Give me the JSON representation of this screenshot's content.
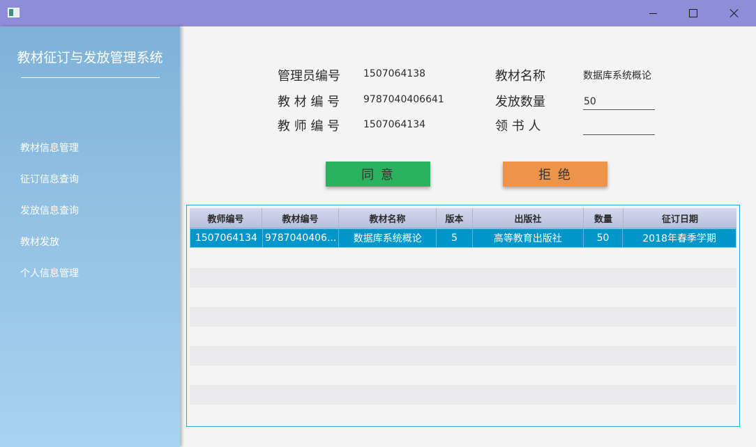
{
  "window": {
    "minimize_icon": "minimize-icon",
    "maximize_icon": "maximize-icon",
    "close_icon": "close-icon"
  },
  "sidebar": {
    "title": "教材征订与发放管理系统",
    "items": [
      {
        "label": "教材信息管理"
      },
      {
        "label": "征订信息查询"
      },
      {
        "label": "发放信息查询"
      },
      {
        "label": "教材发放"
      },
      {
        "label": "个人信息管理"
      }
    ]
  },
  "form": {
    "admin_id_label": "管理员编号",
    "admin_id_value": "1507064138",
    "textbook_id_label": "教 材 编 号",
    "textbook_id_value": "9787040406641",
    "teacher_id_label": "教 师 编 号",
    "teacher_id_value": "1507064134",
    "textbook_name_label": "教材名称",
    "textbook_name_value": "数据库系统概论",
    "quantity_label": "发放数量",
    "quantity_value": "50",
    "recipient_label": "领 书 人",
    "recipient_value": ""
  },
  "actions": {
    "agree_label": "同  意",
    "reject_label": "拒  绝"
  },
  "table": {
    "columns": [
      "教师编号",
      "教材编号",
      "教材名称",
      "版本",
      "出版社",
      "数量",
      "征订日期"
    ],
    "rows": [
      [
        "1507064134",
        "9787040406...",
        "数据库系统概论",
        "5",
        "高等教育出版社",
        "50",
        "2018年春季学期"
      ]
    ]
  },
  "colors": {
    "titlebar": "#8f8cd9",
    "agree": "#2bb25f",
    "reject": "#ed9448",
    "selected_row": "#0096c9"
  }
}
